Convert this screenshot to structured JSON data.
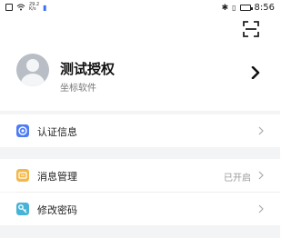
{
  "status_bar": {
    "net_speed_top": "29.2",
    "net_speed_bottom": "K/s",
    "time": "8:56"
  },
  "profile": {
    "name": "测试授权",
    "org": "坐标软件"
  },
  "menu": {
    "auth_info": {
      "label": "认证信息"
    },
    "messages": {
      "label": "消息管理",
      "value": "已开启"
    },
    "password": {
      "label": "修改密码"
    }
  },
  "colors": {
    "auth_icon": "#4f7cf5",
    "message_icon": "#f3b84a",
    "password_icon": "#47b3d6"
  }
}
